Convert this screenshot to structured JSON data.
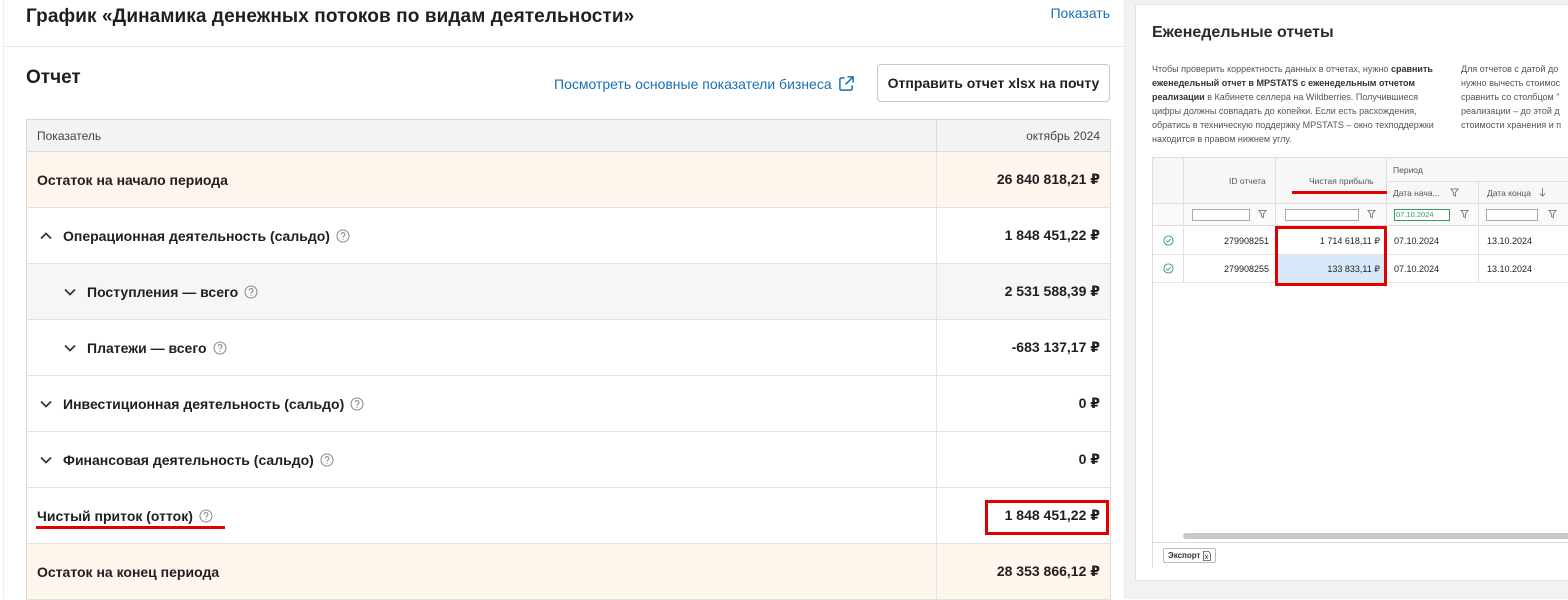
{
  "chart_section": {
    "title": "График «Динамика денежных потоков по видам деятельности»",
    "show_link": "Показать"
  },
  "report": {
    "title": "Отчет",
    "metrics_link": "Посмотреть основные показатели бизнеса",
    "send_button": "Отправить отчет xlsx на почту",
    "columns": {
      "indicator": "Показатель",
      "period": "октябрь 2024"
    },
    "rows": [
      {
        "label": "Остаток на начало периода",
        "value": "26 840 818,21 ₽"
      },
      {
        "label": "Операционная деятельность (сальдо)",
        "value": "1 848 451,22 ₽"
      },
      {
        "label": "Поступления — всего",
        "value": "2 531 588,39 ₽"
      },
      {
        "label": "Платежи — всего",
        "value": "-683 137,17 ₽"
      },
      {
        "label": "Инвестиционная деятельность (сальдо)",
        "value": "0 ₽"
      },
      {
        "label": "Финансовая деятельность (сальдо)",
        "value": "0 ₽"
      },
      {
        "label": "Чистый приток (отток)",
        "value": "1 848 451,22 ₽"
      },
      {
        "label": "Остаток на конец периода",
        "value": "28 353 866,12 ₽"
      }
    ]
  },
  "weekly": {
    "title": "Еженедельные отчеты",
    "note1_a": "Чтобы проверить корректность данных в отчетах, нужно ",
    "note1_b": "сравнить еженедельный отчет в MPSTATS с еженедельным отчетом реализации",
    "note1_c": " в Кабинете селлера на Wildberries. Получившиеся цифры должны совпадать до копейки. Если есть расхождения, обратись в техническую поддержку MPSTATS – окно техподдержки находится в правом нижнем углу.",
    "note2_l1": "Для отчетов с датой до",
    "note2_l2": "нужно вычесть стоимос",
    "note2_l3": "сравнить со столбцом \"",
    "note2_l4": "реализации – до этой д",
    "note2_l5": "стоимости хранения и п",
    "headers": {
      "id": "ID отчета",
      "profit": "Чистая прибыль",
      "period": "Период",
      "start": "Дата нача...",
      "end": "Дата конца"
    },
    "filter_date": "07.10.2024",
    "rows": [
      {
        "id": "279908251",
        "profit": "1 714 618,11 ₽",
        "start": "07.10.2024",
        "end": "13.10.2024"
      },
      {
        "id": "279908255",
        "profit": "133 833,11 ₽",
        "start": "07.10.2024",
        "end": "13.10.2024"
      }
    ],
    "export_label": "Экспорт"
  }
}
